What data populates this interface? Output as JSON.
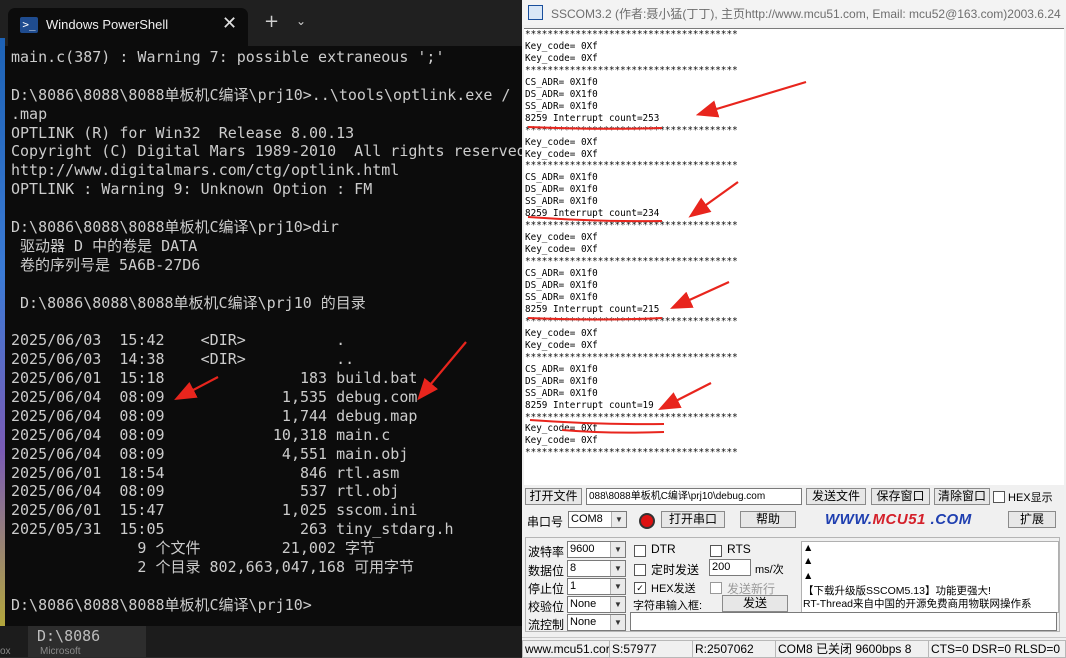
{
  "powershell": {
    "tab_title": "Windows PowerShell",
    "tab_icon": "terminal-icon",
    "close_glyph": "✕",
    "new_tab_glyph": "+",
    "menu_glyph": "⌄",
    "lines": [
      "main.c(387) : Warning 7: possible extraneous ';'",
      "",
      "D:\\8086\\8088\\8088单板机C编译\\prj10>..\\tools\\optlink.exe /",
      ".map",
      "OPTLINK (R) for Win32  Release 8.00.13",
      "Copyright (C) Digital Mars 1989-2010  All rights reserved",
      "http://www.digitalmars.com/ctg/optlink.html",
      "OPTLINK : Warning 9: Unknown Option : FM",
      "",
      "D:\\8086\\8088\\8088单板机C编译\\prj10>dir",
      " 驱动器 D 中的卷是 DATA",
      " 卷的序列号是 5A6B-27D6",
      "",
      " D:\\8086\\8088\\8088单板机C编译\\prj10 的目录",
      "",
      "2025/06/03  15:42    <DIR>          .",
      "2025/06/03  14:38    <DIR>          ..",
      "2025/06/01  15:18               183 build.bat",
      "2025/06/04  08:09             1,535 debug.com",
      "2025/06/04  08:09             1,744 debug.map",
      "2025/06/04  08:09            10,318 main.c",
      "2025/06/04  08:09             4,551 main.obj",
      "2025/06/01  18:54               846 rtl.asm",
      "2025/06/04  08:09               537 rtl.obj",
      "2025/06/01  15:47             1,025 sscom.ini",
      "2025/05/31  15:05               263 tiny_stdarg.h",
      "              9 个文件         21,002 字节",
      "              2 个目录 802,663,047,168 可用字节",
      "",
      "D:\\8086\\8088\\8088单板机C编译\\prj10>"
    ],
    "taskbar_text": "D:\\8086",
    "taskbar_sub": "Microsoft",
    "taskbar_sub2": "ox"
  },
  "sscom": {
    "title": "SSCOM3.2 (作者:聂小猛(丁丁), 主页http://www.mcu51.com,  Email: mcu52@163.com)2003.6.24",
    "rx_lines": [
      "**************************************",
      "Key_code= 0Xf",
      "Key_code= 0Xf",
      "**************************************",
      "CS_ADR= 0X1f0",
      "DS_ADR= 0X1f0",
      "SS_ADR= 0X1f0",
      "8259 Interrupt count=253",
      "**************************************",
      "Key_code= 0Xf",
      "Key_code= 0Xf",
      "**************************************",
      "CS_ADR= 0X1f0",
      "DS_ADR= 0X1f0",
      "SS_ADR= 0X1f0",
      "8259 Interrupt count=234",
      "**************************************",
      "Key_code= 0Xf",
      "Key_code= 0Xf",
      "**************************************",
      "CS_ADR= 0X1f0",
      "DS_ADR= 0X1f0",
      "SS_ADR= 0X1f0",
      "8259 Interrupt count=215",
      "**************************************",
      "Key_code= 0Xf",
      "Key_code= 0Xf",
      "**************************************",
      "CS_ADR= 0X1f0",
      "DS_ADR= 0X1f0",
      "SS_ADR= 0X1f0",
      "8259 Interrupt count=19",
      "**************************************",
      "Key_code= 0Xf",
      "Key_code= 0Xf",
      "**************************************"
    ],
    "open_file_label": "打开文件",
    "file_path": "088\\8088单板机C编译\\prj10\\debug.com",
    "send_file_label": "发送文件",
    "save_window_label": "保存窗口",
    "clear_window_label": "清除窗口",
    "hex_display_label": "HEX显示",
    "port_label": "串口号",
    "port_value": "COM8",
    "open_port_label": "打开串口",
    "help_label": "帮助",
    "logo_prefix": "WWW.",
    "logo_mcu": "MCU51",
    "logo_suffix": " .COM",
    "expand_label": "扩展",
    "baud_label": "波特率",
    "baud_value": "9600",
    "databits_label": "数据位",
    "databits_value": "8",
    "stopbits_label": "停止位",
    "stopbits_value": "1",
    "parity_label": "校验位",
    "parity_value": "None",
    "flow_label": "流控制",
    "flow_value": "None",
    "dtr_label": "DTR",
    "rts_label": "RTS",
    "timed_send_label": "定时发送",
    "interval_value": "200",
    "interval_unit": "ms/次",
    "hex_send_label": "HEX发送",
    "send_newline_label": "发送新行",
    "string_input_label": "字符串输入框:",
    "send_button_label": "发送",
    "news_line1": "【下载升级版SSCOM5.13】功能更强大!",
    "news_line2": "RT-Thread来自中国的开源免费商用物联网操作系",
    "status_site": "www.mcu51.cor",
    "status_sent": "S:57977",
    "status_recv": "R:2507062",
    "status_port": "COM8 已关闭  9600bps  8",
    "status_lines": "CTS=0 DSR=0 RLSD=0"
  },
  "colors": {
    "annotation_red": "#e8251d",
    "terminal_bg": "#0c0c0c",
    "terminal_fg": "#cccccc"
  }
}
